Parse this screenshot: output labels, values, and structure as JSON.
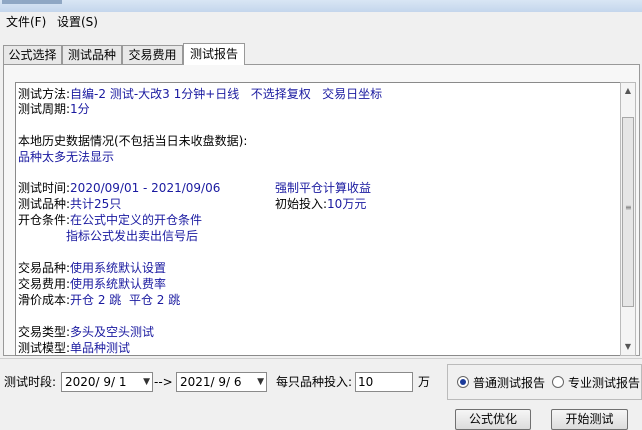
{
  "menu": {
    "file": "文件(F)",
    "settings": "设置(S)"
  },
  "tabs": [
    "公式选择",
    "测试品种",
    "交易费用",
    "测试报告"
  ],
  "report": {
    "method_label": "测试方法:",
    "method_value": "自编-2 测试-大改3 1分钟+日线   不选择复权   交易日坐标",
    "period_label": "测试周期:",
    "period_value": "1分",
    "history_title": "本地历史数据情况(不包括当日未收盘数据):",
    "history_value": "品种太多无法显示",
    "time_label": "测试时间:",
    "time_value": "2020/09/01 - 2021/09/06",
    "force_close": "强制平仓计算收益",
    "symbols_label": "测试品种:",
    "symbols_value": "共计25只",
    "invest_label": "初始投入:",
    "invest_value": "10万元",
    "open_label": "开仓条件:",
    "open_value1": "在公式中定义的开仓条件",
    "open_value2": "指标公式发出卖出信号后",
    "trade_symbols_label": "交易品种:",
    "trade_symbols_value": "使用系统默认设置",
    "fee_label": "交易费用:",
    "fee_value": "使用系统默认费率",
    "slippage_label": "滑价成本:",
    "slippage_value": "开仓 2 跳  平仓 2 跳",
    "trade_type_label": "交易类型:",
    "trade_type_value": "多头及空头测试",
    "model_label": "测试模型:",
    "model_value": "单品种测试"
  },
  "bottom": {
    "period_label": "测试时段:",
    "start_date": "2020/ 9/ 1",
    "arrow": "-->",
    "end_date": "2021/ 9/ 6",
    "invest_label": "每只品种投入:",
    "invest_value": "10",
    "unit": "万",
    "radio_normal": "普通测试报告",
    "radio_pro": "专业测试报告",
    "optimize_button": "公式优化",
    "start_button": "开始测试"
  }
}
